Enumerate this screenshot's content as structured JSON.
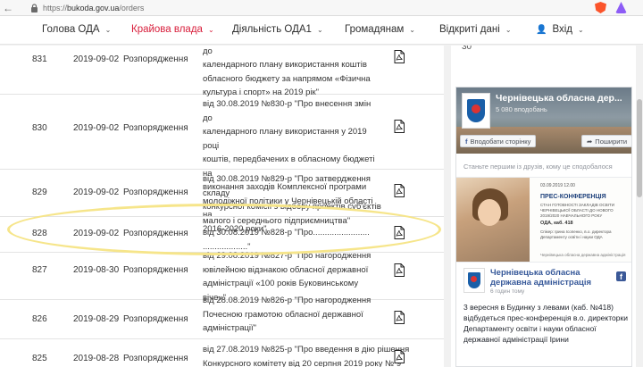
{
  "browser": {
    "url_scheme": "https://",
    "url_host": "bukoda.gov.ua",
    "url_path": "/orders",
    "ext_badge": "1"
  },
  "nav": {
    "items": [
      {
        "label": "Голова ОДА",
        "active": false
      },
      {
        "label": "Крайова влада",
        "active": true
      },
      {
        "label": "Діяльність ОДА1",
        "active": false
      },
      {
        "label": "Громадянам",
        "active": false
      },
      {
        "label": "Відкриті дані",
        "active": false
      },
      {
        "label": "Вхід",
        "active": false
      }
    ],
    "accent_color": "#d81e3b"
  },
  "orders": {
    "rows": [
      {
        "num": "831",
        "date": "2019-09-02",
        "type": "Розпорядження",
        "lines": [
          "від 30.08.2019 №831-р \"Про внесення змін до",
          "календарного плану використання коштів",
          "обласного бюджету за напрямом «Фізична",
          "культура і спорт» на 2019 рік\""
        ]
      },
      {
        "num": "830",
        "date": "2019-09-02",
        "type": "Розпорядження",
        "lines": [
          "від 30.08.2019 №830-р \"Про внесення змін до",
          "календарного плану використання у 2019 році",
          "коштів, передбачених в обласному бюджеті на",
          "виконання заходів Комплексної програми",
          "молодіжної політики у Чернівецькій області на",
          "2016-2020 роки\""
        ]
      },
      {
        "num": "829",
        "date": "2019-09-02",
        "type": "Розпорядження",
        "lines": [
          "від 30.08.2019 №829-р \"Про затвердження складу",
          "конкурсної комісії з відбору проектів суб'єктів",
          "малого і середнього підприємництва\""
        ]
      },
      {
        "num": "828",
        "date": "2019-09-02",
        "type": "Розпорядження",
        "lines": [
          "від 30.08.2019 №828-р \"Про........................ ...................\""
        ]
      },
      {
        "num": "827",
        "date": "2019-08-30",
        "type": "Розпорядження",
        "lines": [
          "від 29.08.2019 №827-р \"Про нагородження",
          "ювілейною відзнакою обласної державної",
          "адміністрації «100 років Буковинському віче»\""
        ]
      },
      {
        "num": "826",
        "date": "2019-08-29",
        "type": "Розпорядження",
        "lines": [
          "від 28.08.2019 №826-р \"Про нагородження",
          "Почесною грамотою обласної державної",
          "адміністрації\""
        ]
      },
      {
        "num": "825",
        "date": "2019-08-28",
        "type": "Розпорядження",
        "lines": [
          "від 27.08.2019 №825-р \"Про введення в дію рішення",
          "Конкурсного комітету від 20 серпня 2019 року № 9\""
        ]
      }
    ]
  },
  "sidebar": {
    "top_number": "30",
    "fb": {
      "page_name": "Чернівецька обласна дер...",
      "page_sub": "5 080 вподобань",
      "like_label": "Вподобати сторінку",
      "share_label": "Поширити",
      "friends_text": "Станьте першим із друзів, кому це сподобалося",
      "poster": {
        "date": "03.09.2019  12.00",
        "title": "ПРЕС-КОНФЕРЕНЦІЯ",
        "subtitle": "СТАН ГОТОВНОСТІ ЗАКЛАДІВ ОСВІТИ ЧЕРНІВЕЦЬКОЇ ОБЛАСТІ ДО НОВОГО 2019/2020 НАВЧАЛЬНОГО РОКУ",
        "room": "ОДА, каб. 418",
        "person": "Спікер: Ірина Ісопенко, в.о. директора Департаменту освіти і науки ОДА",
        "gov": "Чернівецька обласна державна адміністрація"
      },
      "post_author": "Чернівецька обласна державна адміністрація",
      "post_time": "6 годин тому",
      "post_text": "3 вересня в Будинку з левами (каб. №418) відбудеться прес-конференція в.о. директорки Департаменту освіти і науки обласної державної адміністрації Ірини"
    }
  }
}
